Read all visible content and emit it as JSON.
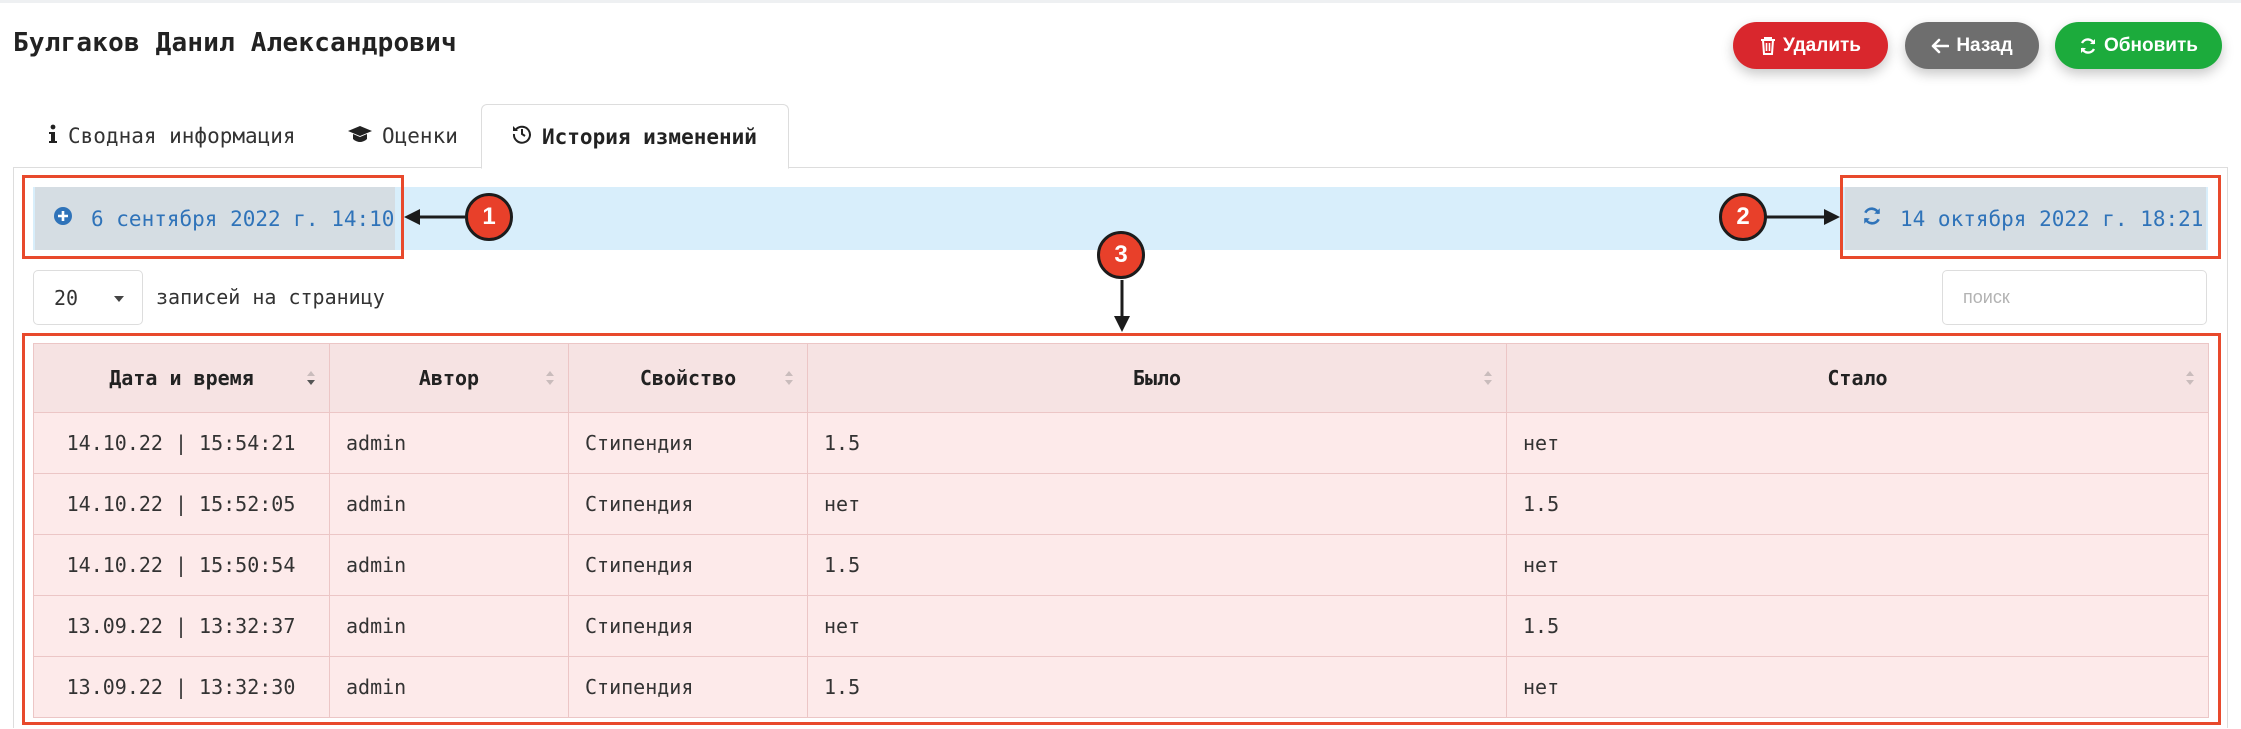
{
  "header": {
    "title": "Булгаков Данил Александрович"
  },
  "actions": {
    "delete": "Удалить",
    "back": "Назад",
    "refresh": "Обновить"
  },
  "tabs": [
    {
      "label": "Сводная информация",
      "icon": "info-icon"
    },
    {
      "label": "Оценки",
      "icon": "graduation-cap-icon"
    },
    {
      "label": "История изменений",
      "icon": "history-icon",
      "active": true
    }
  ],
  "timeline": {
    "start": {
      "label": "6 сентября 2022 г. 14:10",
      "icon": "plus-circle-icon"
    },
    "end": {
      "label": "14 октября 2022 г. 18:21",
      "icon": "refresh-icon"
    }
  },
  "controls": {
    "page_size": "20",
    "page_size_label": "записей на страницу",
    "search_placeholder": "поиск"
  },
  "table": {
    "columns": [
      "Дата и время",
      "Автор",
      "Свойство",
      "Было",
      "Стало"
    ],
    "rows": [
      [
        "14.10.22 | 15:54:21",
        "admin",
        "Стипендия",
        "1.5",
        "нет"
      ],
      [
        "14.10.22 | 15:52:05",
        "admin",
        "Стипендия",
        "нет",
        "1.5"
      ],
      [
        "14.10.22 | 15:50:54",
        "admin",
        "Стипендия",
        "1.5",
        "нет"
      ],
      [
        "13.09.22 | 13:32:37",
        "admin",
        "Стипендия",
        "нет",
        "1.5"
      ],
      [
        "13.09.22 | 13:32:30",
        "admin",
        "Стипендия",
        "1.5",
        "нет"
      ]
    ]
  },
  "annotations": [
    "1",
    "2",
    "3"
  ],
  "colors": {
    "delete": "#d9272d",
    "back": "#6e6e6e",
    "refresh": "#1cab3c",
    "annotation": "#e8492c",
    "link": "#2f73b9",
    "timeline_bg": "#d8eefb"
  }
}
